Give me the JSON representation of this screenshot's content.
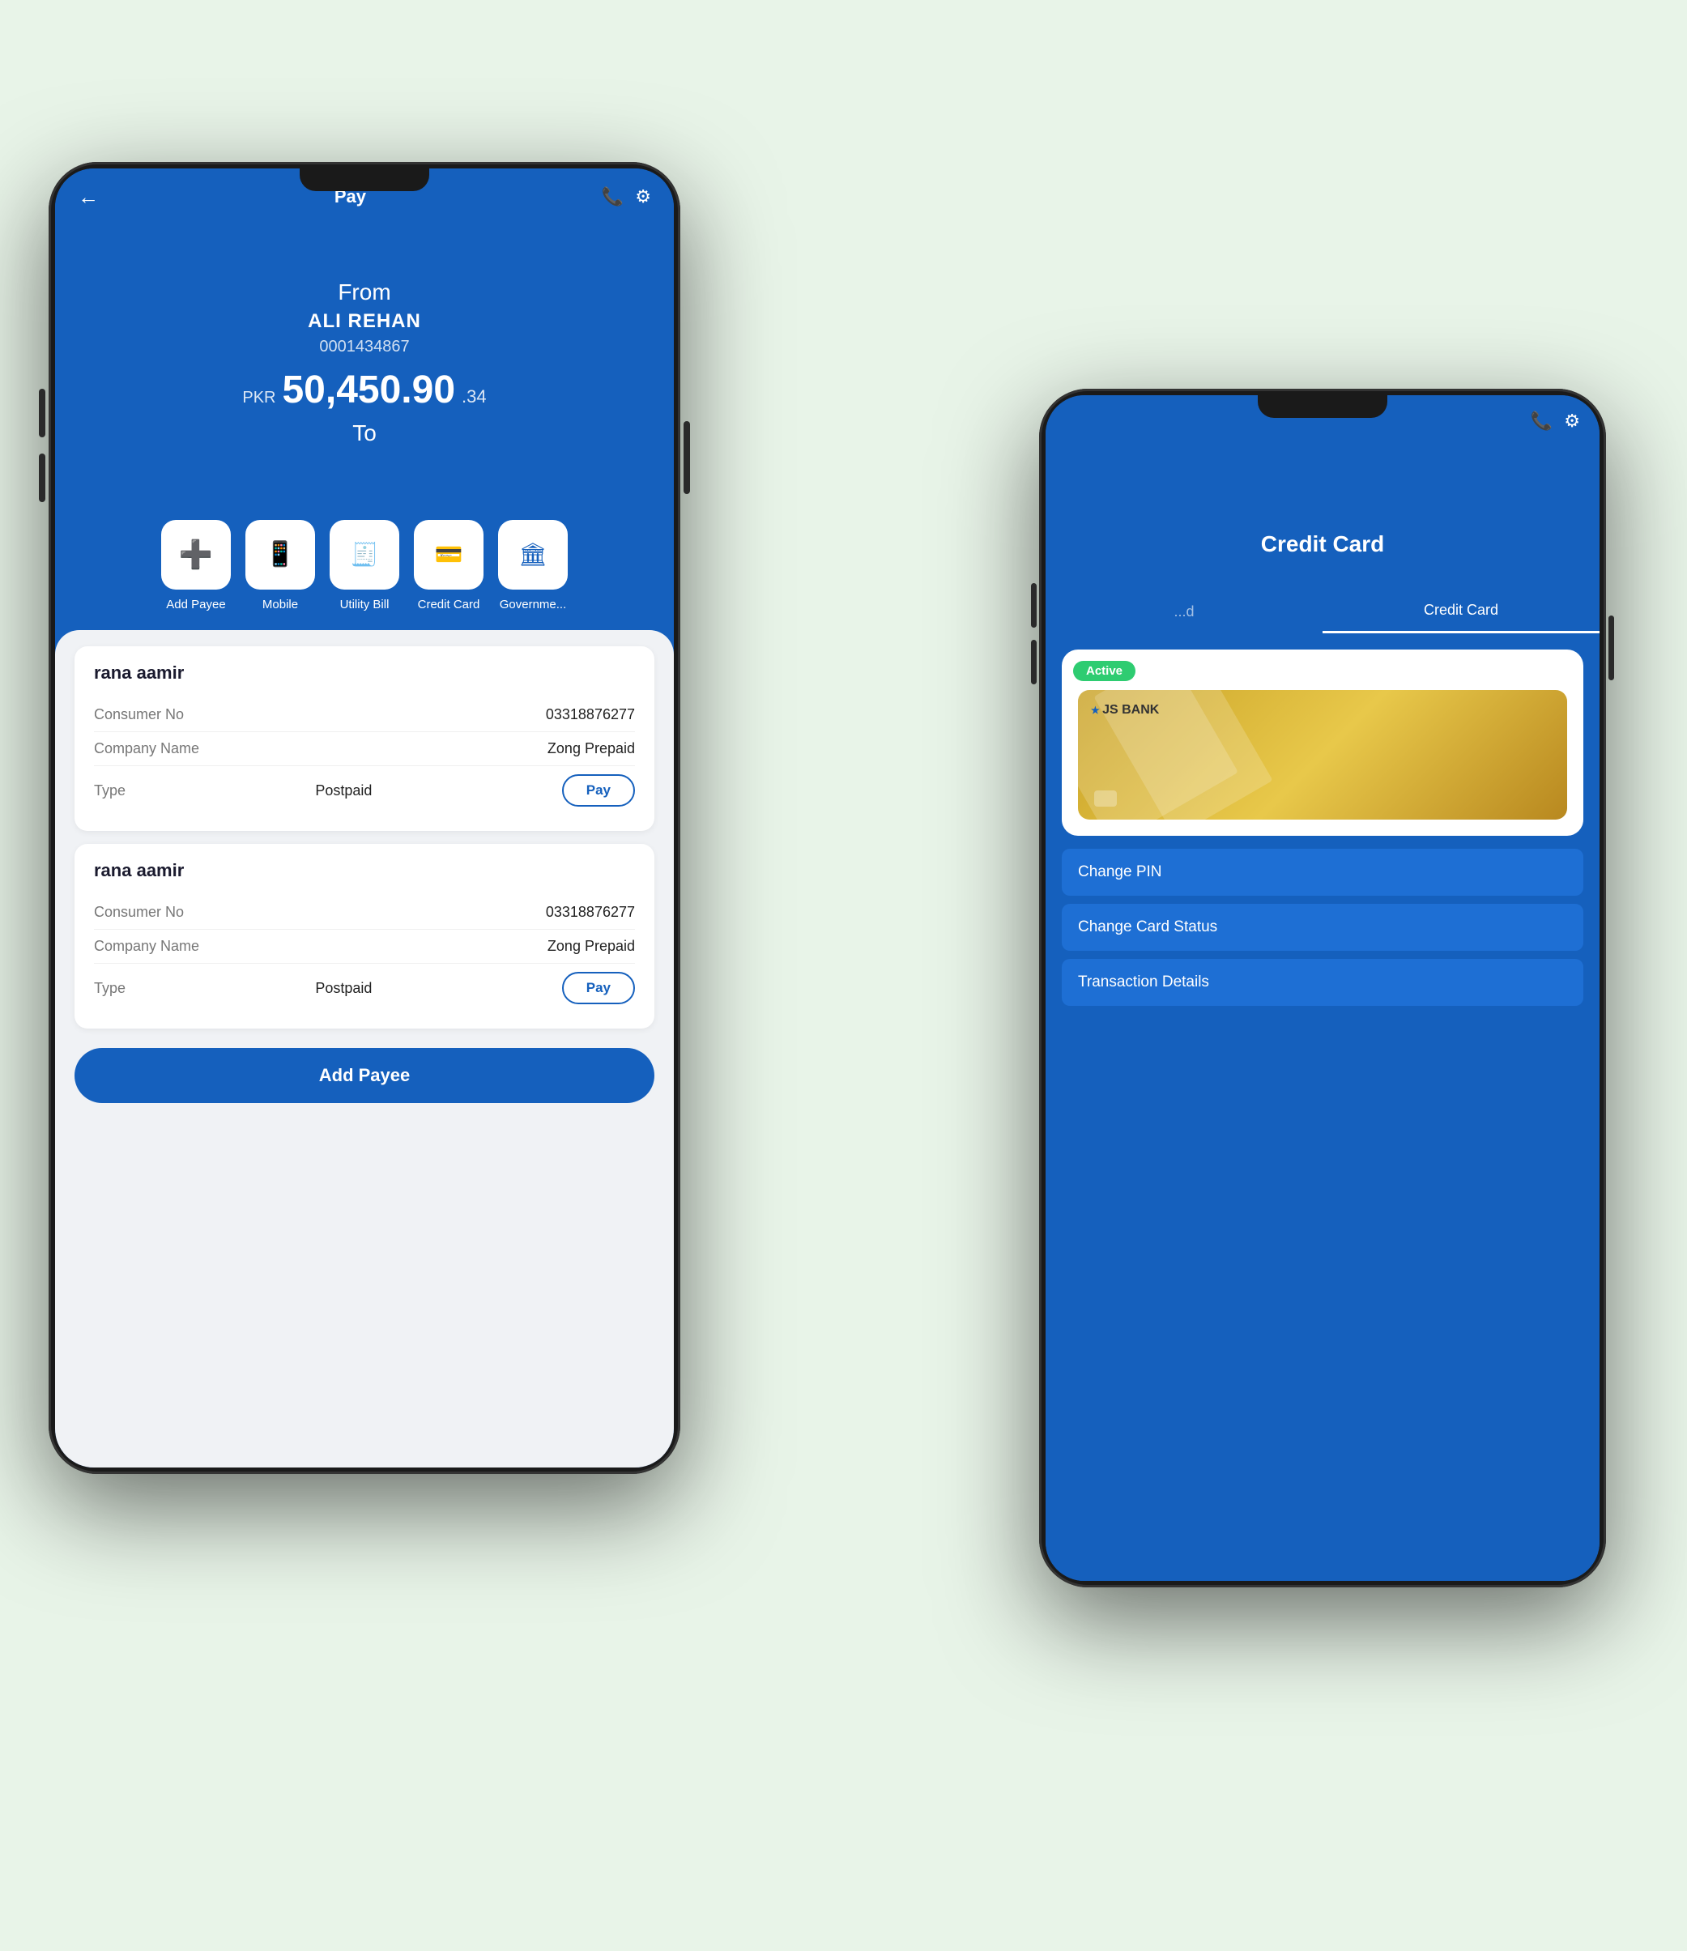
{
  "scene": {
    "bg_color": "#e8f4e8"
  },
  "phone1": {
    "header": {
      "back_icon": "←",
      "title": "Pay",
      "whatsapp_icon": "📞",
      "settings_icon": "⚙"
    },
    "hero": {
      "from_label": "From",
      "name": "ALI REHAN",
      "account": "0001434867",
      "currency": "PKR",
      "amount": "50,450.90",
      "decimal": ".34",
      "to_label": "To"
    },
    "payee_items": [
      {
        "icon": "➕",
        "label": "Add Payee"
      },
      {
        "icon": "📱",
        "label": "Mobile"
      },
      {
        "icon": "📄",
        "label": "Utility Bill"
      },
      {
        "icon": "💳",
        "label": "Credit Card"
      },
      {
        "icon": "🏛",
        "label": "Governme..."
      }
    ],
    "payees": [
      {
        "name": "rana aamir",
        "consumer_no_label": "Consumer No",
        "consumer_no": "03318876277",
        "company_name_label": "Company Name",
        "company_name": "Zong Prepaid",
        "type_label": "Type",
        "type": "Postpaid",
        "pay_btn": "Pay"
      },
      {
        "name": "rana aamir",
        "consumer_no_label": "Consumer No",
        "consumer_no": "03318876277",
        "company_name_label": "Company Name",
        "company_name": "Zong Prepaid",
        "type_label": "Type",
        "type": "Postpaid",
        "pay_btn": "Pay"
      }
    ],
    "add_payee_btn": "Add Payee"
  },
  "phone2": {
    "header": {
      "whatsapp_icon": "📞",
      "settings_icon": "⚙"
    },
    "tabs": [
      {
        "label": "...d",
        "active": false
      },
      {
        "label": "Credit Card",
        "active": true
      }
    ],
    "card": {
      "active_badge": "Active",
      "bank_name": "JS BANK",
      "bank_symbol": "★"
    },
    "actions": [
      {
        "label": "Change PIN"
      },
      {
        "label": "Change Card Status"
      },
      {
        "label": "Transaction Details"
      }
    ]
  }
}
